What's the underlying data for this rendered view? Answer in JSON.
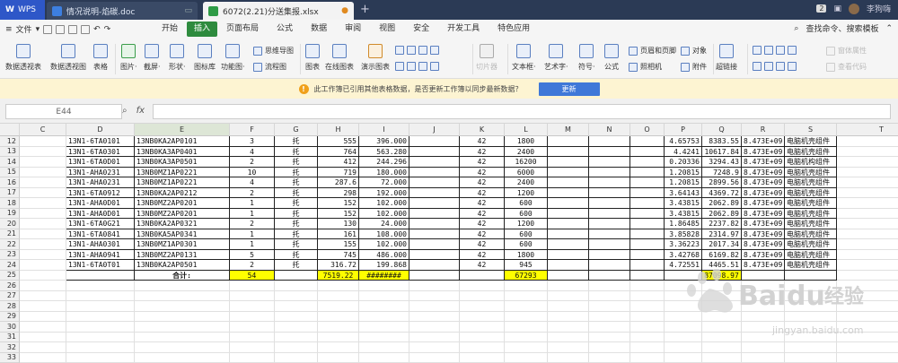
{
  "titlebar": {
    "app_tab": "WPS",
    "tabs": [
      {
        "label": "情况说明-焰碳.doc",
        "type": "doc"
      },
      {
        "label": "6072(2.21)分送集报.xlsx",
        "type": "xlsx"
      }
    ],
    "badge": "2",
    "user": "李狗嗨"
  },
  "menubar": {
    "file_label": "文件",
    "items": [
      "开始",
      "插入",
      "页面布局",
      "公式",
      "数据",
      "审阅",
      "视图",
      "安全",
      "开发工具",
      "特色应用"
    ],
    "active": "插入",
    "search_label": "查找命令、搜索模板"
  },
  "ribbon": {
    "large": [
      {
        "label": "数据透视表"
      },
      {
        "label": "数据透视图"
      },
      {
        "label": "表格"
      },
      {
        "label": "图片·"
      },
      {
        "label": "截屏·"
      },
      {
        "label": "形状·"
      },
      {
        "label": "图标库"
      },
      {
        "label": "功能图·"
      },
      {
        "label": "图表"
      },
      {
        "label": "在线图表"
      },
      {
        "label": "演示图表"
      },
      {
        "label": "切片器"
      },
      {
        "label": "文本框·"
      },
      {
        "label": "艺术字·"
      },
      {
        "label": "符号·"
      },
      {
        "label": "公式"
      },
      {
        "label": "超链接"
      }
    ],
    "small": [
      {
        "label": "思维导图"
      },
      {
        "label": "流程图"
      },
      {
        "label": "页眉和页脚"
      },
      {
        "label": "对象"
      },
      {
        "label": "照相机"
      },
      {
        "label": "附件"
      },
      {
        "label": "窗体属性"
      },
      {
        "label": "查看代码"
      }
    ]
  },
  "notice": {
    "text": "此工作簿已引用其他表格数据，是否更新工作簿以同步最新数据？",
    "button": "更新"
  },
  "formulabar": {
    "cell_ref": "E44",
    "fx": "fx",
    "value": ""
  },
  "grid": {
    "columns": [
      "C",
      "D",
      "E",
      "F",
      "G",
      "H",
      "I",
      "J",
      "K",
      "L",
      "M",
      "N",
      "O",
      "P",
      "Q",
      "R",
      "S",
      "T"
    ],
    "selected_column": "E",
    "rows": [
      {
        "n": "12",
        "D": "13N1-6TA0101",
        "E": "13NB0KA2AP0101",
        "F": "3",
        "G": "托",
        "H": "555",
        "I": "396.000",
        "K": "42",
        "L": "1800",
        "P": "4.65753",
        "Q": "8383.55",
        "R": "8.473E+09",
        "S": "电脑机壳组件"
      },
      {
        "n": "13",
        "D": "13N1-6TA0301",
        "E": "13NB0KA3AP0401",
        "F": "4",
        "G": "托",
        "H": "764",
        "I": "563.280",
        "K": "42",
        "L": "2400",
        "P": "4.4241",
        "Q": "10617.84",
        "R": "8.473E+09",
        "S": "电脑机壳组件"
      },
      {
        "n": "14",
        "D": "13N1-6TA0D01",
        "E": "13NB0KA3AP0501",
        "F": "2",
        "G": "托",
        "H": "412",
        "I": "244.296",
        "K": "42",
        "L": "16200",
        "P": "0.20336",
        "Q": "3294.43",
        "R": "8.473E+09",
        "S": "电脑机构组件"
      },
      {
        "n": "15",
        "D": "13N1-AHA0231",
        "E": "13NB0MZ1AP0221",
        "F": "10",
        "G": "托",
        "H": "719",
        "I": "180.000",
        "K": "42",
        "L": "6000",
        "P": "1.20815",
        "Q": "7248.9",
        "R": "8.473E+09",
        "S": "电脑机壳组件"
      },
      {
        "n": "16",
        "D": "13N1-AHA0231",
        "E": "13NB0MZ1AP0221",
        "F": "4",
        "G": "托",
        "H": "287.6",
        "I": "72.000",
        "K": "42",
        "L": "2400",
        "P": "1.20815",
        "Q": "2899.56",
        "R": "8.473E+09",
        "S": "电脑机壳组件"
      },
      {
        "n": "17",
        "D": "13N1-6TA0912",
        "E": "13NB0KA2AP0212",
        "F": "2",
        "G": "托",
        "H": "298",
        "I": "192.000",
        "K": "42",
        "L": "1200",
        "P": "3.64143",
        "Q": "4369.72",
        "R": "8.473E+09",
        "S": "电脑机壳组件"
      },
      {
        "n": "18",
        "D": "13N1-AHA0D01",
        "E": "13NB0MZ2AP0201",
        "F": "1",
        "G": "托",
        "H": "152",
        "I": "102.000",
        "K": "42",
        "L": "600",
        "P": "3.43815",
        "Q": "2062.89",
        "R": "8.473E+09",
        "S": "电脑机壳组件"
      },
      {
        "n": "19",
        "D": "13N1-AHA0D01",
        "E": "13NB0MZ2AP0201",
        "F": "1",
        "G": "托",
        "H": "152",
        "I": "102.000",
        "K": "42",
        "L": "600",
        "P": "3.43815",
        "Q": "2062.89",
        "R": "8.473E+09",
        "S": "电脑机壳组件"
      },
      {
        "n": "20",
        "D": "13N1-6TA0G21",
        "E": "13NB0KA2AP0321",
        "F": "2",
        "G": "托",
        "H": "130",
        "I": "24.000",
        "K": "42",
        "L": "1200",
        "P": "1.86485",
        "Q": "2237.82",
        "R": "8.473E+09",
        "S": "电脑机壳组件"
      },
      {
        "n": "21",
        "D": "13N1-6TA0841",
        "E": "13NB0KA5AP0341",
        "F": "1",
        "G": "托",
        "H": "161",
        "I": "108.000",
        "K": "42",
        "L": "600",
        "P": "3.85828",
        "Q": "2314.97",
        "R": "8.473E+09",
        "S": "电脑机壳组件"
      },
      {
        "n": "22",
        "D": "13N1-AHA0301",
        "E": "13NB0MZ1AP0301",
        "F": "1",
        "G": "托",
        "H": "155",
        "I": "102.000",
        "K": "42",
        "L": "600",
        "P": "3.36223",
        "Q": "2017.34",
        "R": "8.473E+09",
        "S": "电脑机壳组件"
      },
      {
        "n": "23",
        "D": "13N1-AHA0941",
        "E": "13NB0MZ2AP0131",
        "F": "5",
        "G": "托",
        "H": "745",
        "I": "486.000",
        "K": "42",
        "L": "1800",
        "P": "3.42768",
        "Q": "6169.82",
        "R": "8.473E+09",
        "S": "电脑机壳组件"
      },
      {
        "n": "24",
        "D": "13N1-6TA0T01",
        "E": "13NB0KA2AP0501",
        "F": "2",
        "G": "托",
        "H": "316.72",
        "I": "199.868",
        "K": "42",
        "L": "945",
        "P": "4.72551",
        "Q": "4465.51",
        "R": "8.473E+09",
        "S": "电脑机壳组件"
      },
      {
        "n": "25",
        "E": "合计:",
        "F": "54",
        "H": "7519.22",
        "I": "########",
        "L": "67293",
        "Q": "87098.97",
        "total": true
      },
      {
        "n": "26"
      },
      {
        "n": "27"
      },
      {
        "n": "28"
      },
      {
        "n": "29"
      },
      {
        "n": "30"
      },
      {
        "n": "31"
      },
      {
        "n": "32"
      },
      {
        "n": "33"
      }
    ]
  },
  "colors": {
    "title_bg": "#2b3a55",
    "wps_blue": "#2e57c8",
    "insert_green": "#2e8b3e",
    "notice_bg": "#fdf4d2",
    "update_blue": "#3f78d8",
    "highlight_yellow": "#ffff00"
  }
}
